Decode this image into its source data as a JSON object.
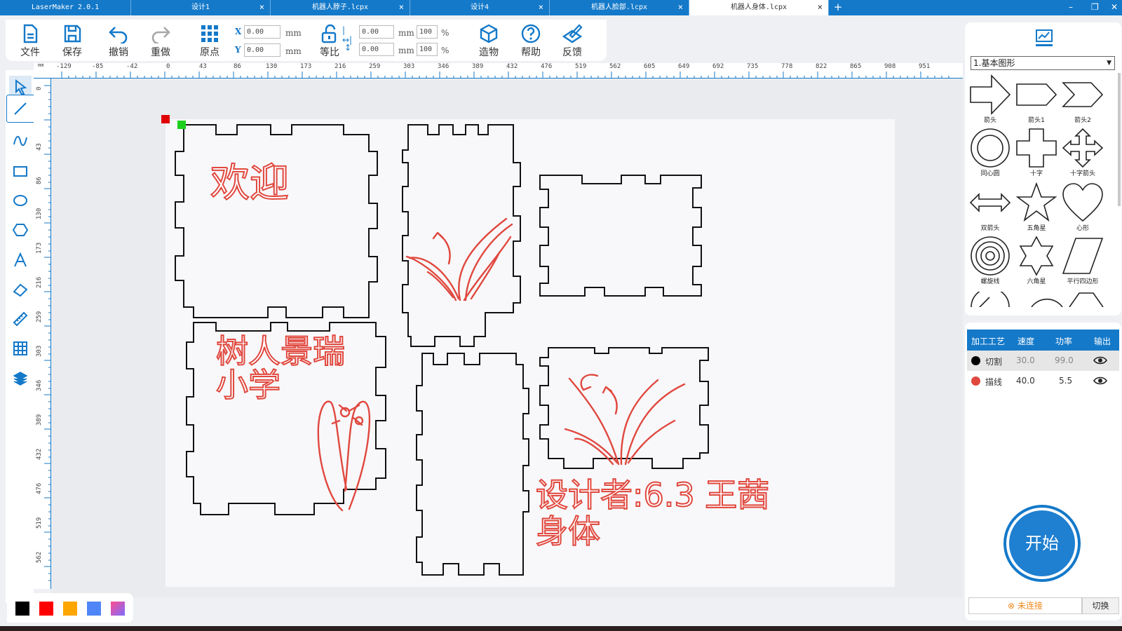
{
  "tabs": [
    {
      "label": "LaserMaker 2.0.1",
      "active": false,
      "closable": false
    },
    {
      "label": "设计1",
      "active": false,
      "closable": true
    },
    {
      "label": "机器人脖子.lcpx",
      "active": false,
      "closable": true
    },
    {
      "label": "设计4",
      "active": false,
      "closable": true
    },
    {
      "label": "机器人脸部.lcpx",
      "active": false,
      "closable": true
    },
    {
      "label": "机器人身体.lcpx",
      "active": true,
      "closable": true
    }
  ],
  "tab_close": "×",
  "tab_add": "+",
  "window_controls": {
    "minimize": "–",
    "restore": "❐",
    "close": "✕"
  },
  "toolbar": {
    "file": "文件",
    "save": "保存",
    "undo": "撤销",
    "redo": "重做",
    "origin": "原点",
    "ratio": "等比",
    "build": "造物",
    "help": "帮助",
    "feedback": "反馈",
    "x_label": "X",
    "y_label": "Y",
    "x_value": "0.00",
    "y_value": "0.00",
    "unit_mm": "mm",
    "width_value": "0.00",
    "height_value": "0.00",
    "width_pct": "100",
    "height_pct": "100",
    "pct": "%"
  },
  "ruler": {
    "top_ticks": [
      "-129",
      "-85",
      "-42",
      "0",
      "43",
      "86",
      "130",
      "173",
      "216",
      "259",
      "303",
      "346",
      "389",
      "432",
      "476",
      "519",
      "562",
      "605",
      "649",
      "692",
      "735",
      "778",
      "822",
      "865",
      "908",
      "951"
    ],
    "left_ticks": [
      "0",
      "43",
      "86",
      "130",
      "173",
      "216",
      "259",
      "303",
      "346",
      "389",
      "432",
      "476",
      "519",
      "562"
    ],
    "corner": "mm"
  },
  "line_tool_tooltip": "直线",
  "canvas_text": {
    "welcome": "欢迎",
    "school_line1": "树人景瑞",
    "school_line2": "小学",
    "designer_line1": "设计者:6.3 王茜",
    "designer_line2": "身体"
  },
  "colors": {
    "accent": "#1479c9",
    "engrave_red": "#e0483e",
    "cut_black": "#111111"
  },
  "palette": [
    "#000000",
    "#ff0000",
    "#ffa500",
    "#4f86f7",
    "gradient"
  ],
  "shape_library": {
    "category": "1.基本图形",
    "shapes": [
      "箭头",
      "箭头1",
      "箭头2",
      "同心圆",
      "十字",
      "十字箭头",
      "双箭头",
      "五角星",
      "心形",
      "螺旋线",
      "六角星",
      "平行四边形"
    ]
  },
  "process": {
    "headers": [
      "加工工艺",
      "速度",
      "功率",
      "输出"
    ],
    "rows": [
      {
        "name": "切割",
        "color": "#000000",
        "speed": "30.0",
        "power": "99.0"
      },
      {
        "name": "描线",
        "color": "#e0483e",
        "speed": "40.0",
        "power": "5.5"
      }
    ]
  },
  "start_button": "开始",
  "connection_status": "未连接",
  "switch_button": "切换"
}
